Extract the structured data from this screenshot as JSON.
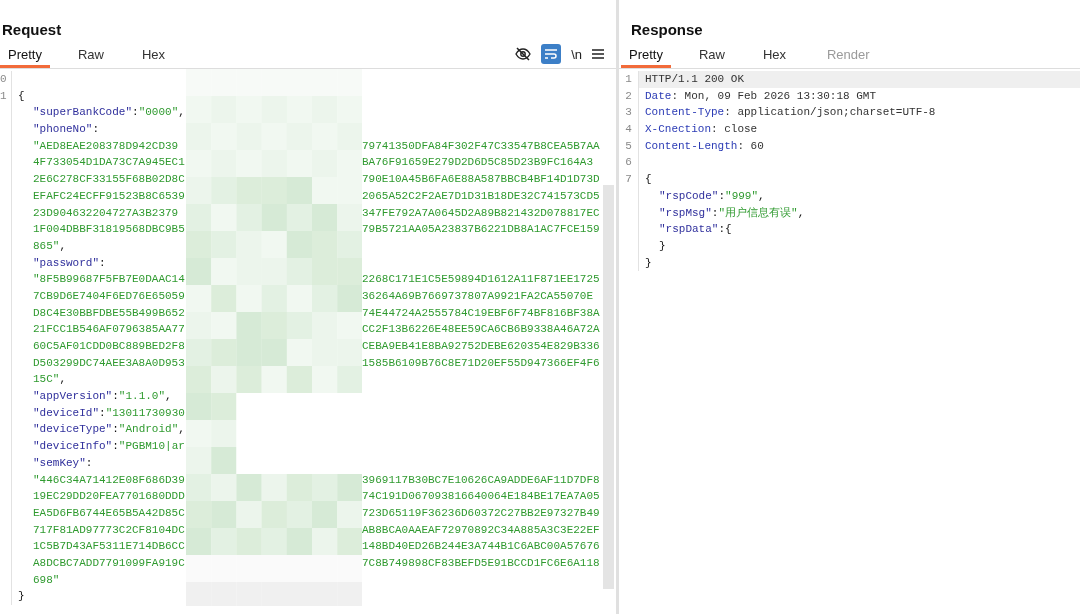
{
  "request": {
    "title": "Request",
    "tabs": [
      {
        "label": "Pretty",
        "selected": true,
        "disabled": false
      },
      {
        "label": "Raw",
        "selected": false,
        "disabled": false
      },
      {
        "label": "Hex",
        "selected": false,
        "disabled": false
      }
    ],
    "toolbar": {
      "wrap_lines": true,
      "newline_label": "\\n"
    },
    "lines": [
      {
        "number": "0",
        "indented": false
      },
      {
        "number": "1",
        "indented": false,
        "tokens": [
          {
            "kind": "punct",
            "text": "{"
          }
        ]
      },
      {
        "indented": true,
        "tokens": [
          {
            "kind": "key",
            "text": "\"superBankCode\""
          },
          {
            "kind": "punct",
            "text": ":"
          },
          {
            "kind": "string",
            "text": "\"0000\""
          },
          {
            "kind": "punct",
            "text": ","
          }
        ]
      },
      {
        "indented": true,
        "tokens": [
          {
            "kind": "key",
            "text": "\"phoneNo\""
          },
          {
            "kind": "punct",
            "text": ":"
          }
        ]
      },
      {
        "indented": true,
        "tokens": [
          {
            "kind": "string",
            "text": "\"AED8EAE208378D942CD39"
          }
        ],
        "tail": "79741350DFA84F302F47C33547B8CEA5B7AA"
      },
      {
        "indented": true,
        "tokens": [
          {
            "kind": "string",
            "text": "4F733054D1DA73C7A945EC1"
          }
        ],
        "tail": "BA76F91659E279D2D6D5C85D23B9FC164A3"
      },
      {
        "indented": true,
        "tokens": [
          {
            "kind": "string",
            "text": "2E6C278CF33155F68B02D8C"
          }
        ],
        "tail": "790E10A45B6FA6E88A587BBCB4BF14D1D73D"
      },
      {
        "indented": true,
        "tokens": [
          {
            "kind": "string",
            "text": "EFAFC24ECFF91523B8C6539"
          }
        ],
        "tail": "2065A52C2F2AE7D1D31B18DE32C741573CD5"
      },
      {
        "indented": true,
        "tokens": [
          {
            "kind": "string",
            "text": "23D904632204727A3B2379"
          }
        ],
        "tail": "347FE792A7A0645D2A89B821432D078817EC"
      },
      {
        "indented": true,
        "tokens": [
          {
            "kind": "string",
            "text": "1F004DBBF31819568DBC9B5"
          }
        ],
        "tail": "79B5721AA05A23837B6221DB8A1AC7FCE159"
      },
      {
        "indented": true,
        "tokens": [
          {
            "kind": "string",
            "text": "865\""
          },
          {
            "kind": "punct",
            "text": ","
          }
        ]
      },
      {
        "indented": true,
        "tokens": [
          {
            "kind": "key",
            "text": "\"password\""
          },
          {
            "kind": "punct",
            "text": ":"
          }
        ]
      },
      {
        "indented": true,
        "tokens": [
          {
            "kind": "string",
            "text": "\"8F5B99687F5FB7E0DAAC14"
          }
        ],
        "tail": "2268C171E1C5E59894D1612A11F871EE1725"
      },
      {
        "indented": true,
        "tokens": [
          {
            "kind": "string",
            "text": "7CB9D6E7404F6ED76E65059"
          }
        ],
        "tail": "36264A69B7669737807A9921FA2CA55070E"
      },
      {
        "indented": true,
        "tokens": [
          {
            "kind": "string",
            "text": "D8C4E30BBFDBE55B499B652"
          }
        ],
        "tail": "74E44724A2555784C19EBF6F74BF816BF38A"
      },
      {
        "indented": true,
        "tokens": [
          {
            "kind": "string",
            "text": "21FCC1B546AF0796385AA77"
          }
        ],
        "tail": "CC2F13B6226E48EE59CA6CB6B9338A46A72A"
      },
      {
        "indented": true,
        "tokens": [
          {
            "kind": "string",
            "text": "60C5AF01CDD0BC889BED2F8"
          }
        ],
        "tail": "CEBA9EB41E8BA92752DEBE620354E829B336"
      },
      {
        "indented": true,
        "tokens": [
          {
            "kind": "string",
            "text": "D503299DC74AEE3A8A0D953"
          }
        ],
        "tail": "1585B6109B76C8E71D20EF55D947366EF4F6"
      },
      {
        "indented": true,
        "tokens": [
          {
            "kind": "string",
            "text": "15C\""
          },
          {
            "kind": "punct",
            "text": ","
          }
        ]
      },
      {
        "indented": true,
        "tokens": [
          {
            "kind": "key",
            "text": "\"appVersion\""
          },
          {
            "kind": "punct",
            "text": ":"
          },
          {
            "kind": "string",
            "text": "\"1.1.0\""
          },
          {
            "kind": "punct",
            "text": ","
          }
        ]
      },
      {
        "indented": true,
        "tokens": [
          {
            "kind": "key",
            "text": "\"deviceId\""
          },
          {
            "kind": "punct",
            "text": ":"
          },
          {
            "kind": "string",
            "text": "\"13011730930"
          }
        ]
      },
      {
        "indented": true,
        "tokens": [
          {
            "kind": "key",
            "text": "\"deviceType\""
          },
          {
            "kind": "punct",
            "text": ":"
          },
          {
            "kind": "string",
            "text": "\"Android\""
          },
          {
            "kind": "punct",
            "text": ","
          }
        ]
      },
      {
        "indented": true,
        "tokens": [
          {
            "kind": "key",
            "text": "\"deviceInfo\""
          },
          {
            "kind": "punct",
            "text": ":"
          },
          {
            "kind": "string",
            "text": "\"PGBM10|ar"
          }
        ]
      },
      {
        "indented": true,
        "tokens": [
          {
            "kind": "key",
            "text": "\"semKey\""
          },
          {
            "kind": "punct",
            "text": ":"
          }
        ]
      },
      {
        "indented": true,
        "tokens": [
          {
            "kind": "string",
            "text": "\"446C34A71412E08F686D39"
          }
        ],
        "tail": "3969117B30BC7E10626CA9ADDE6AF11D7DF8"
      },
      {
        "indented": true,
        "tokens": [
          {
            "kind": "string",
            "text": "19EC29DD20FEA7701680DDD"
          }
        ],
        "tail": "74C191D067093816640064E184BE17EA7A05"
      },
      {
        "indented": true,
        "tokens": [
          {
            "kind": "string",
            "text": "EA5D6FB6744E65B5A42D85C"
          }
        ],
        "tail": "723D65119F36236D60372C27BB2E97327B49"
      },
      {
        "indented": true,
        "tokens": [
          {
            "kind": "string",
            "text": "717F81AD97773C2CF8104DC"
          }
        ],
        "tail": "AB8BCA0AAEAF72970892C34A885A3C3E22EF"
      },
      {
        "indented": true,
        "tokens": [
          {
            "kind": "string",
            "text": "1C5B7D43AF5311E714DB6CC"
          }
        ],
        "tail": "148BD40ED26B244E3A744B1C6ABC00A57676"
      },
      {
        "indented": true,
        "tokens": [
          {
            "kind": "string",
            "text": "A8DCBC7ADD7791099FA919C"
          }
        ],
        "tail": "7C8B749898CF83BEFD5E91BCCD1FC6E6A118"
      },
      {
        "indented": true,
        "tokens": [
          {
            "kind": "string",
            "text": "698\""
          }
        ]
      },
      {
        "indented": false,
        "tokens": [
          {
            "kind": "punct",
            "text": "}"
          }
        ]
      }
    ]
  },
  "response": {
    "title": "Response",
    "tabs": [
      {
        "label": "Pretty",
        "selected": true,
        "disabled": false
      },
      {
        "label": "Raw",
        "selected": false,
        "disabled": false
      },
      {
        "label": "Hex",
        "selected": false,
        "disabled": false
      },
      {
        "label": "Render",
        "selected": false,
        "disabled": true
      }
    ],
    "lines": [
      {
        "number": "1",
        "indented": false,
        "highlighted": true,
        "tokens": [
          {
            "kind": "plain",
            "text": "HTTP/1.1 200 OK"
          }
        ]
      },
      {
        "number": "2",
        "indented": false,
        "highlighted": false,
        "tokens": [
          {
            "kind": "header",
            "text": "Date"
          },
          {
            "kind": "plain",
            "text": ": Mon, 09 Feb 2026 13:30:18 GMT"
          }
        ]
      },
      {
        "number": "3",
        "indented": false,
        "highlighted": false,
        "tokens": [
          {
            "kind": "header",
            "text": "Content-Type"
          },
          {
            "kind": "plain",
            "text": ": application/json;charset=UTF-8"
          }
        ]
      },
      {
        "number": "4",
        "indented": false,
        "highlighted": false,
        "tokens": [
          {
            "kind": "header",
            "text": "X-Cnection"
          },
          {
            "kind": "plain",
            "text": ": close"
          }
        ]
      },
      {
        "number": "5",
        "indented": false,
        "highlighted": false,
        "tokens": [
          {
            "kind": "header",
            "text": "Content-Length"
          },
          {
            "kind": "plain",
            "text": ": 60"
          }
        ]
      },
      {
        "number": "6",
        "indented": false,
        "highlighted": false
      },
      {
        "number": "7",
        "indented": false,
        "highlighted": false,
        "tokens": [
          {
            "kind": "punct",
            "text": "{"
          }
        ]
      },
      {
        "indented": true,
        "highlighted": false,
        "tokens": [
          {
            "kind": "key",
            "text": "\"rspCode\""
          },
          {
            "kind": "punct",
            "text": ":"
          },
          {
            "kind": "string",
            "text": "\"999\""
          },
          {
            "kind": "punct",
            "text": ","
          }
        ]
      },
      {
        "indented": true,
        "highlighted": false,
        "tokens": [
          {
            "kind": "key",
            "text": "\"rspMsg\""
          },
          {
            "kind": "punct",
            "text": ":"
          },
          {
            "kind": "string",
            "text": "\"用户信息有误\""
          },
          {
            "kind": "punct",
            "text": ","
          }
        ]
      },
      {
        "indented": true,
        "highlighted": false,
        "tokens": [
          {
            "kind": "key",
            "text": "\"rspData\""
          },
          {
            "kind": "punct",
            "text": ":{"
          }
        ]
      },
      {
        "indented": true,
        "highlighted": false,
        "tokens": [
          {
            "kind": "punct",
            "text": "}"
          }
        ]
      },
      {
        "indented": false,
        "highlighted": false,
        "tokens": [
          {
            "kind": "punct",
            "text": "}"
          }
        ]
      }
    ]
  }
}
